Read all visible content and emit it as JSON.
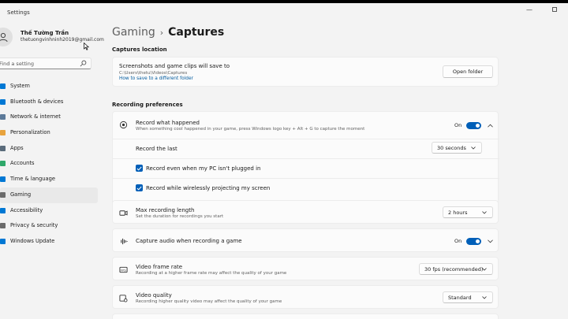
{
  "window": {
    "title": "Settings"
  },
  "user": {
    "name": "Thế Tường Trần",
    "email": "thetuongvinhninh2019@gmail.com"
  },
  "search": {
    "placeholder": "Find a setting"
  },
  "nav": {
    "items": [
      {
        "label": "System",
        "icon": "monitor-icon",
        "color": "#0078d4"
      },
      {
        "label": "Bluetooth & devices",
        "icon": "bluetooth-icon",
        "color": "#0078d4"
      },
      {
        "label": "Network & internet",
        "icon": "wifi-icon",
        "color": "#5c7a99"
      },
      {
        "label": "Personalization",
        "icon": "brush-icon",
        "color": "#e8a33d"
      },
      {
        "label": "Apps",
        "icon": "apps-icon",
        "color": "#5a6b7b"
      },
      {
        "label": "Accounts",
        "icon": "person-icon",
        "color": "#2fa86a"
      },
      {
        "label": "Time & language",
        "icon": "globe-clock-icon",
        "color": "#0078d4"
      },
      {
        "label": "Gaming",
        "icon": "gamepad-icon",
        "color": "#6b6b6b",
        "active": true
      },
      {
        "label": "Accessibility",
        "icon": "accessibility-icon",
        "color": "#0078d4"
      },
      {
        "label": "Privacy & security",
        "icon": "shield-icon",
        "color": "#6b6b6b"
      },
      {
        "label": "Windows Update",
        "icon": "update-icon",
        "color": "#0078d4"
      }
    ]
  },
  "breadcrumb": {
    "parent": "Gaming",
    "separator": "›",
    "current": "Captures"
  },
  "captures_location": {
    "section_title": "Captures location",
    "title": "Screenshots and game clips will save to",
    "path": "C:\\Users\\thetu\\Videos\\Captures",
    "link": "How to save to a different folder",
    "button": "Open folder"
  },
  "recording_preferences": {
    "section_title": "Recording preferences",
    "record_what_happened": {
      "title": "Record what happened",
      "subtitle": "When something cool happened in your game, press Windows logo key + Alt + G to capture the moment",
      "state": "On"
    },
    "record_the_last": {
      "label": "Record the last",
      "value": "30 seconds"
    },
    "checkbox_unplugged": "Record even when my PC isn't plugged in",
    "checkbox_wireless": "Record while wirelessly projecting my screen",
    "max_length": {
      "title": "Max recording length",
      "subtitle": "Set the duration for recordings you start",
      "value": "2 hours"
    },
    "capture_audio": {
      "title": "Capture audio when recording a game",
      "state": "On"
    },
    "frame_rate": {
      "title": "Video frame rate",
      "subtitle": "Recording at a higher frame rate may affect the quality of your game",
      "value": "30 fps (recommended)"
    },
    "video_quality": {
      "title": "Video quality",
      "subtitle": "Recording higher quality video may affect the quality of your game",
      "value": "Standard"
    }
  },
  "colors": {
    "accent": "#005fb8",
    "link": "#005a9e"
  }
}
